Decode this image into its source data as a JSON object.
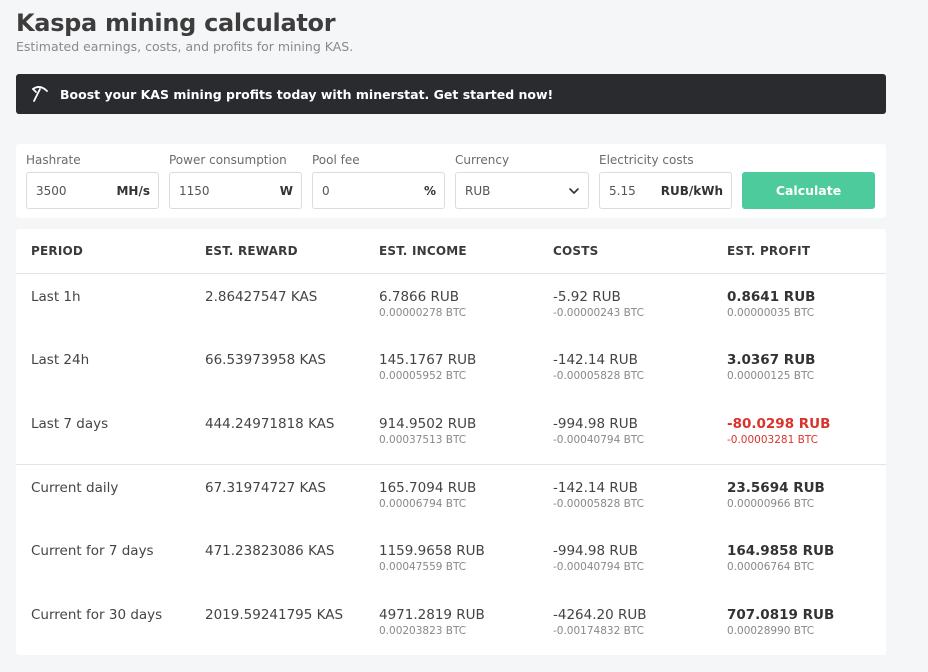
{
  "page": {
    "title": "Kaspa mining calculator",
    "subtitle": "Estimated earnings, costs, and profits for mining KAS."
  },
  "banner": {
    "text": "Boost your KAS mining profits today with minerstat. Get started now!",
    "icon": "pickaxe-icon"
  },
  "form": {
    "hashrate": {
      "label": "Hashrate",
      "value": "3500",
      "unit": "MH/s"
    },
    "power": {
      "label": "Power consumption",
      "value": "1150",
      "unit": "W"
    },
    "pool_fee": {
      "label": "Pool fee",
      "value": "0",
      "unit": "%"
    },
    "currency": {
      "label": "Currency",
      "value": "RUB"
    },
    "electricity": {
      "label": "Electricity costs",
      "value": "5.15",
      "unit": "RUB/kWh"
    },
    "calculate_label": "Calculate"
  },
  "table": {
    "headers": [
      "PERIOD",
      "EST. REWARD",
      "EST. INCOME",
      "COSTS",
      "EST. PROFIT"
    ],
    "rows": [
      {
        "period": "Last 1h",
        "reward": "2.86427547 KAS",
        "income": "6.7866 RUB",
        "income_btc": "0.00000278 BTC",
        "costs": "-5.92 RUB",
        "costs_btc": "-0.00000243 BTC",
        "profit": "0.8641 RUB",
        "profit_btc": "0.00000035 BTC"
      },
      {
        "period": "Last 24h",
        "reward": "66.53973958 KAS",
        "income": "145.1767 RUB",
        "income_btc": "0.00005952 BTC",
        "costs": "-142.14 RUB",
        "costs_btc": "-0.00005828 BTC",
        "profit": "3.0367 RUB",
        "profit_btc": "0.00000125 BTC"
      },
      {
        "period": "Last 7 days",
        "reward": "444.24971818 KAS",
        "income": "914.9502 RUB",
        "income_btc": "0.00037513 BTC",
        "costs": "-994.98 RUB",
        "costs_btc": "-0.00040794 BTC",
        "profit": "-80.0298 RUB",
        "profit_btc": "-0.00003281 BTC"
      },
      {
        "period": "Current daily",
        "reward": "67.31974727 KAS",
        "income": "165.7094 RUB",
        "income_btc": "0.00006794 BTC",
        "costs": "-142.14 RUB",
        "costs_btc": "-0.00005828 BTC",
        "profit": "23.5694 RUB",
        "profit_btc": "0.00000966 BTC"
      },
      {
        "period": "Current for 7 days",
        "reward": "471.23823086 KAS",
        "income": "1159.9658 RUB",
        "income_btc": "0.00047559 BTC",
        "costs": "-994.98 RUB",
        "costs_btc": "-0.00040794 BTC",
        "profit": "164.9858 RUB",
        "profit_btc": "0.00006764 BTC"
      },
      {
        "period": "Current for 30 days",
        "reward": "2019.59241795 KAS",
        "income": "4971.2819 RUB",
        "income_btc": "0.00203823 BTC",
        "costs": "-4264.20 RUB",
        "costs_btc": "-0.00174832 BTC",
        "profit": "707.0819 RUB",
        "profit_btc": "0.00028990 BTC"
      }
    ]
  },
  "colors": {
    "banner_bg": "#2a2b2f",
    "calculate_bg": "#4ecb9d",
    "negative": "#d9342b"
  }
}
